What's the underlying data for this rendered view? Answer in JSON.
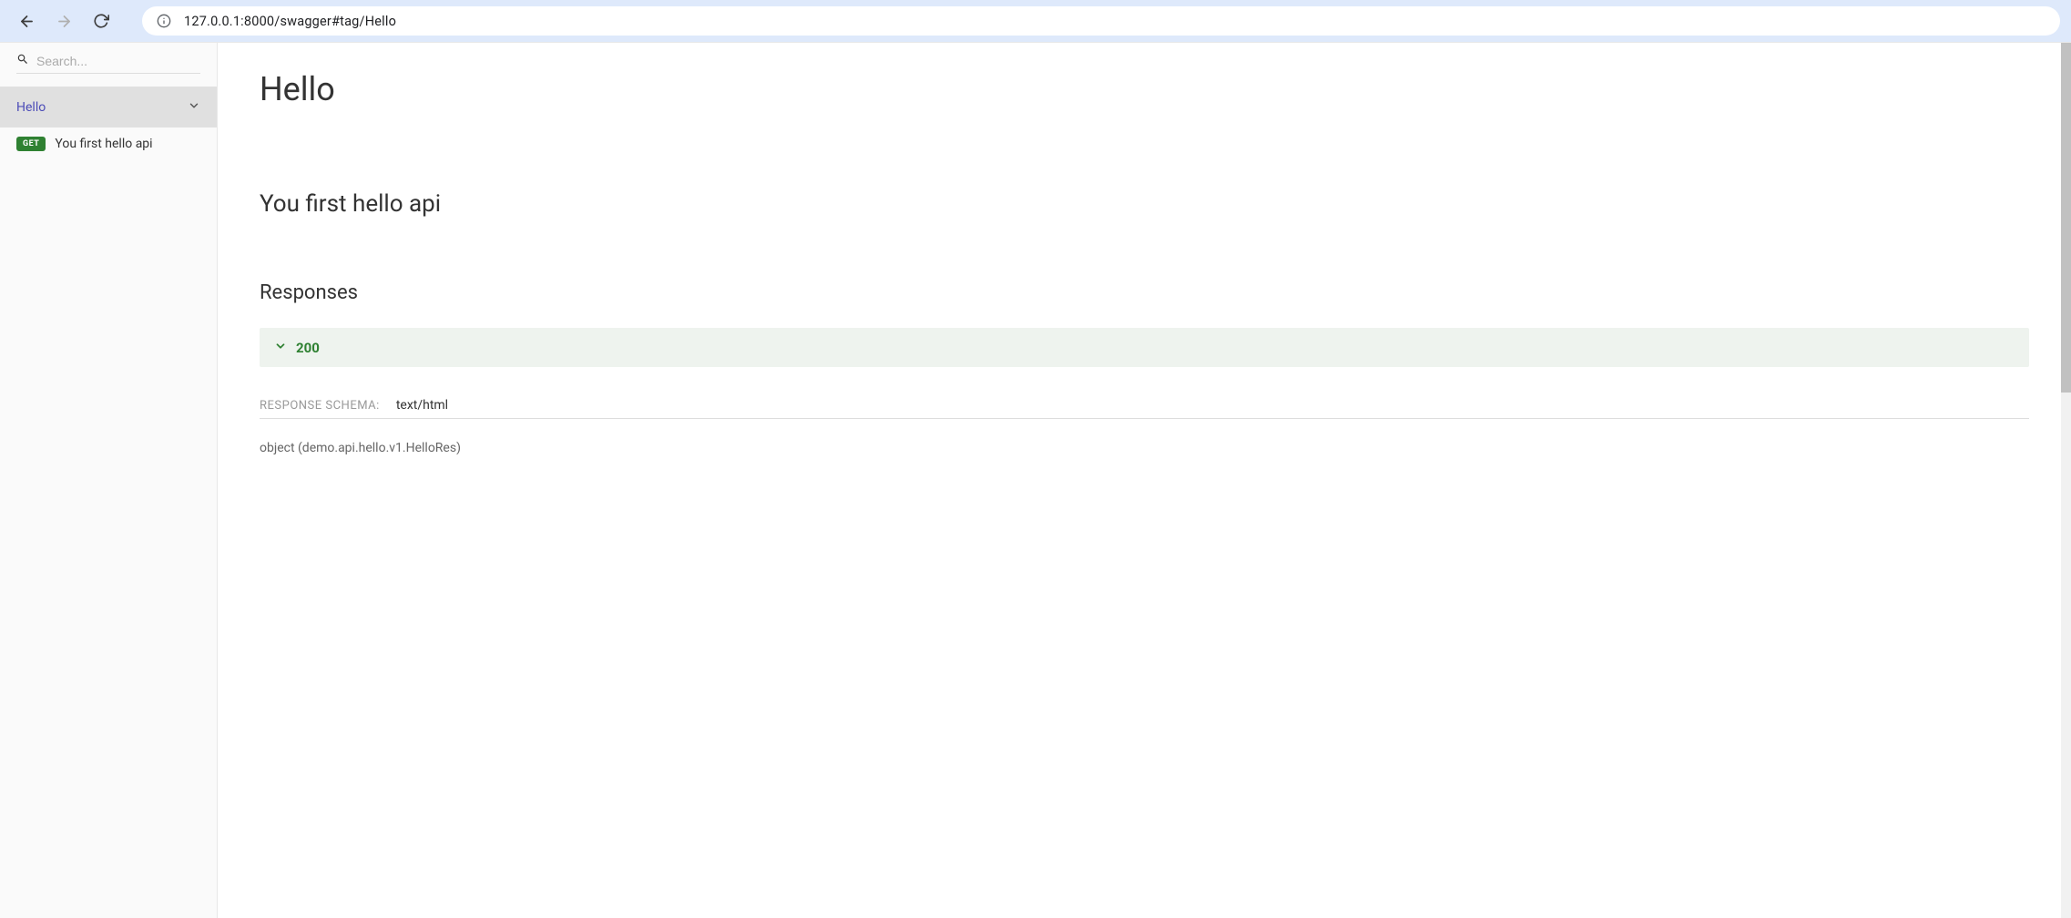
{
  "browser": {
    "url": "127.0.0.1:8000/swagger#tag/Hello"
  },
  "sidebar": {
    "search_placeholder": "Search...",
    "tag": {
      "label": "Hello"
    },
    "operation": {
      "method": "GET",
      "label": "You first hello api"
    }
  },
  "content": {
    "tag_title": "Hello",
    "endpoint_title": "You first hello api",
    "responses_heading": "Responses",
    "response": {
      "code": "200"
    },
    "schema": {
      "label": "RESPONSE SCHEMA:",
      "content_type": "text/html",
      "object": "object (demo.api.hello.v1.HelloRes)"
    }
  }
}
